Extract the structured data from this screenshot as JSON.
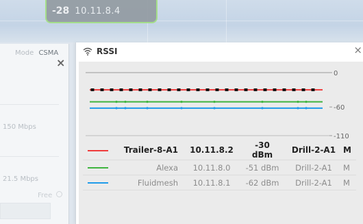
{
  "top_node": {
    "rssi": "-28",
    "ip": "10.11.8.4"
  },
  "side_panel": {
    "mode_label": "Mode",
    "mode_value": "CSMA",
    "close_glyph": "×",
    "rate_1": "150 Mbps",
    "rate_2": "21.5 Mbps",
    "free_label": "Free"
  },
  "dialog": {
    "title": "RSSI",
    "close_glyph": "×"
  },
  "chart_data": {
    "type": "line",
    "ylim": [
      -110,
      0
    ],
    "y_ticks": [
      {
        "value": 0,
        "label": "0"
      },
      {
        "value": -60,
        "label": "-60"
      },
      {
        "value": -110,
        "label": "-110"
      }
    ],
    "series": [
      {
        "name": "Trailer-8-A1",
        "ip": "10.11.8.2",
        "signal": "-30 dBm",
        "device": "Drill-2-A1",
        "flag": "M",
        "value": -30,
        "color": "#ef3b3b",
        "bold": true
      },
      {
        "name": "Alexa",
        "ip": "10.11.8.0",
        "signal": "-51 dBm",
        "device": "Drill-2-A1",
        "flag": "M",
        "value": -51,
        "color": "#3fb43f",
        "bold": false
      },
      {
        "name": "Fluidmesh",
        "ip": "10.11.8.1",
        "signal": "-62 dBm",
        "device": "Drill-2-A1",
        "flag": "M",
        "value": -62,
        "color": "#1f9bea",
        "bold": false
      }
    ]
  }
}
